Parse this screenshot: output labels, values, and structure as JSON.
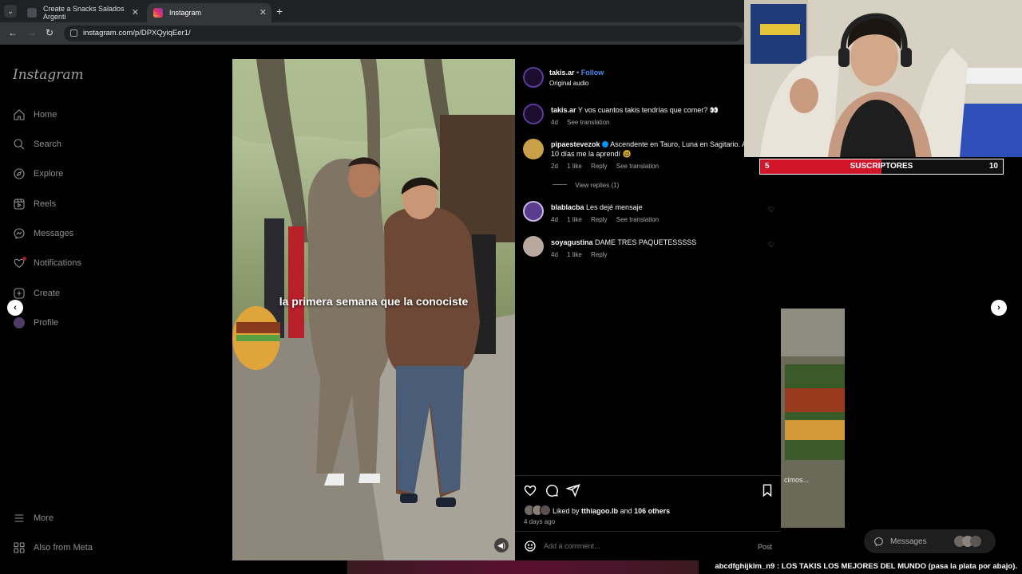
{
  "browser": {
    "tabs": [
      {
        "label": "Create a Snacks Salados Argenti"
      },
      {
        "label": "Instagram"
      }
    ],
    "url": "instagram.com/p/DPXQyiqEer1/"
  },
  "sidebar": {
    "logo": "Instagram",
    "items": [
      {
        "label": "Home",
        "icon": "home-icon"
      },
      {
        "label": "Search",
        "icon": "search-icon"
      },
      {
        "label": "Explore",
        "icon": "compass-icon"
      },
      {
        "label": "Reels",
        "icon": "reels-icon"
      },
      {
        "label": "Messages",
        "icon": "messenger-icon"
      },
      {
        "label": "Notifications",
        "icon": "heart-icon"
      },
      {
        "label": "Create",
        "icon": "plus-icon"
      },
      {
        "label": "Profile",
        "icon": "profile-icon"
      }
    ],
    "bottom": [
      {
        "label": "More",
        "icon": "menu-icon"
      },
      {
        "label": "Also from Meta",
        "icon": "meta-icon"
      }
    ]
  },
  "media": {
    "caption": "la primera semana que la conociste"
  },
  "post": {
    "author": "takis.ar",
    "follow": "Follow",
    "separator": "•",
    "audio": "Original audio",
    "caption_user": "takis.ar",
    "caption_text": "Y vos cuantos takis tendrías que comer? 👀",
    "caption_age": "4d",
    "see_translation": "See translation",
    "comments": [
      {
        "user": "pipaestevezok",
        "text": "Ascendente en Tauro, Luna en Sagitario. A",
        "text2": "10 días me la aprendí 🤓",
        "age": "2d",
        "likes": "1 like",
        "reply": "Reply",
        "translate": "See translation",
        "verified": true
      },
      {
        "user": "blablacba",
        "text": "Les dejé mensaje",
        "age": "4d",
        "likes": "1 like",
        "reply": "Reply",
        "translate": "See translation"
      },
      {
        "user": "soyagustina",
        "text": "DAME TRES PAQUETESSSSS",
        "age": "4d",
        "likes": "1 like",
        "reply": "Reply"
      }
    ],
    "view_replies": "View replies (1)",
    "liked_by_prefix": "Liked by",
    "liked_by_user": "tthiagoo.lb",
    "liked_and": "and",
    "liked_others": "106 others",
    "posted": "4 days ago",
    "add_comment_placeholder": "Add a comment...",
    "post_button": "Post"
  },
  "stream": {
    "sub_current": "5",
    "sub_label": "SUSCRIPTORES",
    "sub_goal": "10",
    "sub_progress": 0.5,
    "preview_text": "cimos...",
    "messages": "Messages",
    "ticker": "abcdfghijklm_n9 : LOS TAKIS LOS MEJORES DEL MUNDO (pasa la plata por abajo)."
  },
  "colors": {
    "follow": "#4f8cf6",
    "subbar_fill": "#d2162a"
  }
}
